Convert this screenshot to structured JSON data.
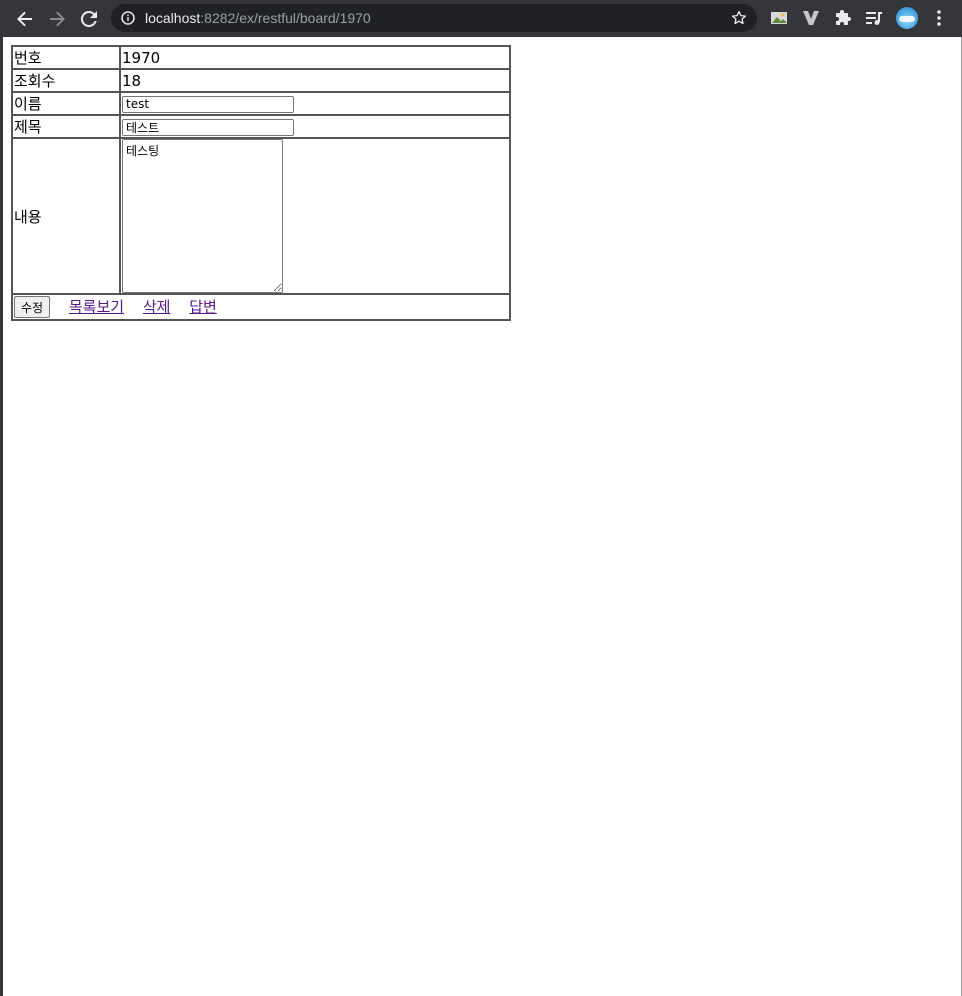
{
  "browser": {
    "url_host": "localhost",
    "url_path": ":8282/ex/restful/board/1970",
    "icons": [
      "back-arrow-icon",
      "forward-arrow-icon",
      "reload-icon",
      "info-icon",
      "star-icon",
      "image-extension-icon",
      "v-extension-icon",
      "puzzle-icon",
      "media-queue-icon",
      "profile-avatar",
      "more-vert-icon"
    ]
  },
  "board": {
    "rows": {
      "num_label": "번호",
      "num_value": "1970",
      "hit_label": "조회수",
      "hit_value": "18",
      "name_label": "이름",
      "name_value": "test",
      "title_label": "제목",
      "title_value": "테스트",
      "content_label": "내용",
      "content_value": "테스팅"
    },
    "actions": {
      "modify_label": "수정",
      "list_label": "목록보기",
      "delete_label": "삭제",
      "reply_label": "답변"
    }
  },
  "colors": {
    "chrome_bg": "#35363a",
    "omnibox_bg": "#202124",
    "visited_link": "#551a8b"
  }
}
